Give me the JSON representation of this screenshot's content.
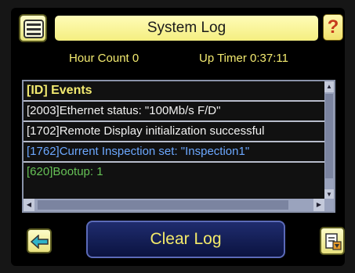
{
  "header": {
    "title": "System Log",
    "help_label": "?",
    "menu_icon": "menu-icon"
  },
  "status": {
    "hour_count": "Hour Count  0",
    "up_timer": "Up Timer  0:37:11"
  },
  "log": {
    "header": "[ID]  Events",
    "rows": [
      {
        "text": "[2003]Ethernet status:  \"100Mb/s F/D\"",
        "color": "#f2f2f2"
      },
      {
        "text": "[1702]Remote Display initialization successful",
        "color": "#f2f2f2"
      },
      {
        "text": "[1762]Current Inspection set:  \"Inspection1\"",
        "color": "#6ca8ff"
      },
      {
        "text": "[620]Bootup:  1",
        "color": "#66c256"
      }
    ]
  },
  "footer": {
    "clear_label": "Clear Log",
    "back_icon": "back-arrow-icon",
    "save_icon": "save-log-icon"
  },
  "colors": {
    "accent": "#f3ea70",
    "panel_border": "#8a93aa"
  }
}
